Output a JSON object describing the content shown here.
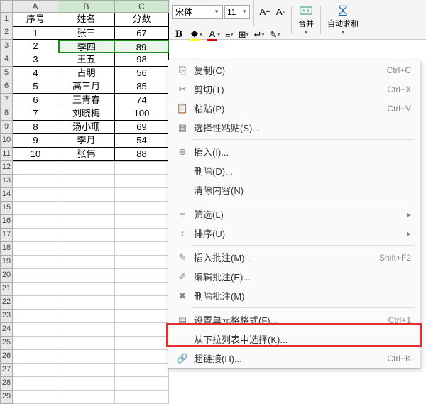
{
  "toolbar": {
    "font_name": "宋体",
    "font_size": "11",
    "merge_label": "合并",
    "autosum_label": "自动求和"
  },
  "columns": [
    "A",
    "B",
    "C"
  ],
  "headers": {
    "a": "序号",
    "b": "姓名",
    "c": "分数"
  },
  "rows": [
    {
      "a": "1",
      "b": "张三",
      "c": "67"
    },
    {
      "a": "2",
      "b": "李四",
      "c": "89"
    },
    {
      "a": "3",
      "b": "王五",
      "c": "98"
    },
    {
      "a": "4",
      "b": "占明",
      "c": "56"
    },
    {
      "a": "5",
      "b": "高三月",
      "c": "85"
    },
    {
      "a": "6",
      "b": "王青春",
      "c": "74"
    },
    {
      "a": "7",
      "b": "刘晓梅",
      "c": "100"
    },
    {
      "a": "8",
      "b": "汤小珊",
      "c": "69"
    },
    {
      "a": "9",
      "b": "李月",
      "c": "54"
    },
    {
      "a": "10",
      "b": "张伟",
      "c": "88"
    }
  ],
  "ctx": {
    "copy": {
      "label": "复制(C)",
      "short": "Ctrl+C"
    },
    "cut": {
      "label": "剪切(T)",
      "short": "Ctrl+X"
    },
    "paste": {
      "label": "粘贴(P)",
      "short": "Ctrl+V"
    },
    "pspec": {
      "label": "选择性粘贴(S)..."
    },
    "insert": {
      "label": "插入(I)..."
    },
    "delete": {
      "label": "删除(D)..."
    },
    "clear": {
      "label": "清除内容(N)"
    },
    "filter": {
      "label": "筛选(L)"
    },
    "sort": {
      "label": "排序(U)"
    },
    "addnote": {
      "label": "插入批注(M)...",
      "short": "Shift+F2"
    },
    "editnote": {
      "label": "编辑批注(E)..."
    },
    "delnote": {
      "label": "删除批注(M)"
    },
    "format": {
      "label": "设置单元格格式(F)...",
      "short": "Ctrl+1"
    },
    "picklist": {
      "label": "从下拉列表中选择(K)..."
    },
    "link": {
      "label": "超链接(H)...",
      "short": "Ctrl+K"
    }
  }
}
